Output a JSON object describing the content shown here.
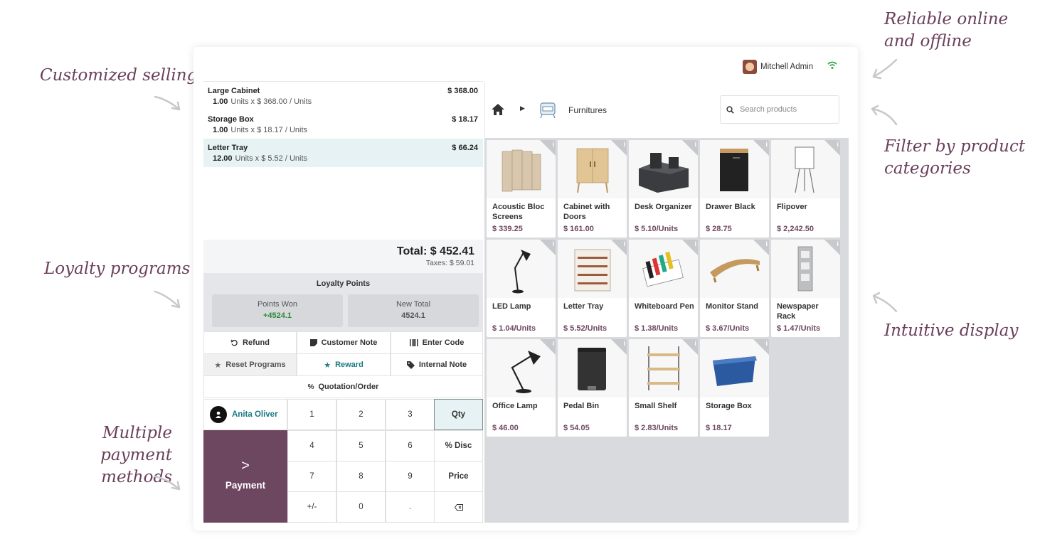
{
  "callouts": {
    "customized_selling": "Customized selling",
    "loyalty_programs": "Loyalty programs",
    "multiple_payment_1": "Multiple payment",
    "multiple_payment_2": "methods",
    "reliable_1": "Reliable online",
    "reliable_2": "and offline",
    "filter_1": "Filter by product",
    "filter_2": "categories",
    "intuitive": "Intuitive display"
  },
  "header": {
    "user_name": "Mitchell Admin"
  },
  "order": {
    "lines": [
      {
        "name": "Large Cabinet",
        "price": "$ 368.00",
        "qty": "1.00",
        "unit_info": "Units x $ 368.00 / Units"
      },
      {
        "name": "Storage Box",
        "price": "$ 18.17",
        "qty": "1.00",
        "unit_info": "Units x $ 18.17 / Units"
      },
      {
        "name": "Letter Tray",
        "price": "$ 66.24",
        "qty": "12.00",
        "unit_info": "Units x $ 5.52 / Units"
      }
    ],
    "total": "Total: $ 452.41",
    "taxes": "Taxes: $ 59.01"
  },
  "loyalty": {
    "heading": "Loyalty Points",
    "won_label": "Points Won",
    "won_value": "+4524.1",
    "new_total_label": "New Total",
    "new_total_value": "4524.1"
  },
  "controls": {
    "refund": "Refund",
    "customer_note": "Customer Note",
    "enter_code": "Enter Code",
    "reset_programs": "Reset Programs",
    "reward": "Reward",
    "internal_note": "Internal Note",
    "quotation": "Quotation/Order"
  },
  "numpad": {
    "customer": "Anita Oliver",
    "payment": "Payment",
    "keys": [
      "1",
      "2",
      "3",
      "Qty",
      "4",
      "5",
      "6",
      "% Disc",
      "7",
      "8",
      "9",
      "Price",
      "+/-",
      "0",
      "."
    ]
  },
  "category": {
    "label": "Furnitures",
    "search_placeholder": "Search products"
  },
  "products": [
    {
      "name": "Acoustic Bloc Screens",
      "price": "$ 339.25"
    },
    {
      "name": "Cabinet with Doors",
      "price": "$ 161.00"
    },
    {
      "name": "Desk Organizer",
      "price": "$ 5.10/Units"
    },
    {
      "name": "Drawer Black",
      "price": "$ 28.75"
    },
    {
      "name": "Flipover",
      "price": "$ 2,242.50"
    },
    {
      "name": "LED Lamp",
      "price": "$ 1.04/Units"
    },
    {
      "name": "Letter Tray",
      "price": "$ 5.52/Units"
    },
    {
      "name": "Whiteboard Pen",
      "price": "$ 1.38/Units"
    },
    {
      "name": "Monitor Stand",
      "price": "$ 3.67/Units"
    },
    {
      "name": "Newspaper Rack",
      "price": "$ 1.47/Units"
    },
    {
      "name": "Office Lamp",
      "price": "$ 46.00"
    },
    {
      "name": "Pedal Bin",
      "price": "$ 54.05"
    },
    {
      "name": "Small Shelf",
      "price": "$ 2.83/Units"
    },
    {
      "name": "Storage Box",
      "price": "$ 18.17"
    }
  ],
  "colors": {
    "accent": "#6d4760",
    "teal": "#1a7a82",
    "won_green": "#2e8b3a"
  }
}
